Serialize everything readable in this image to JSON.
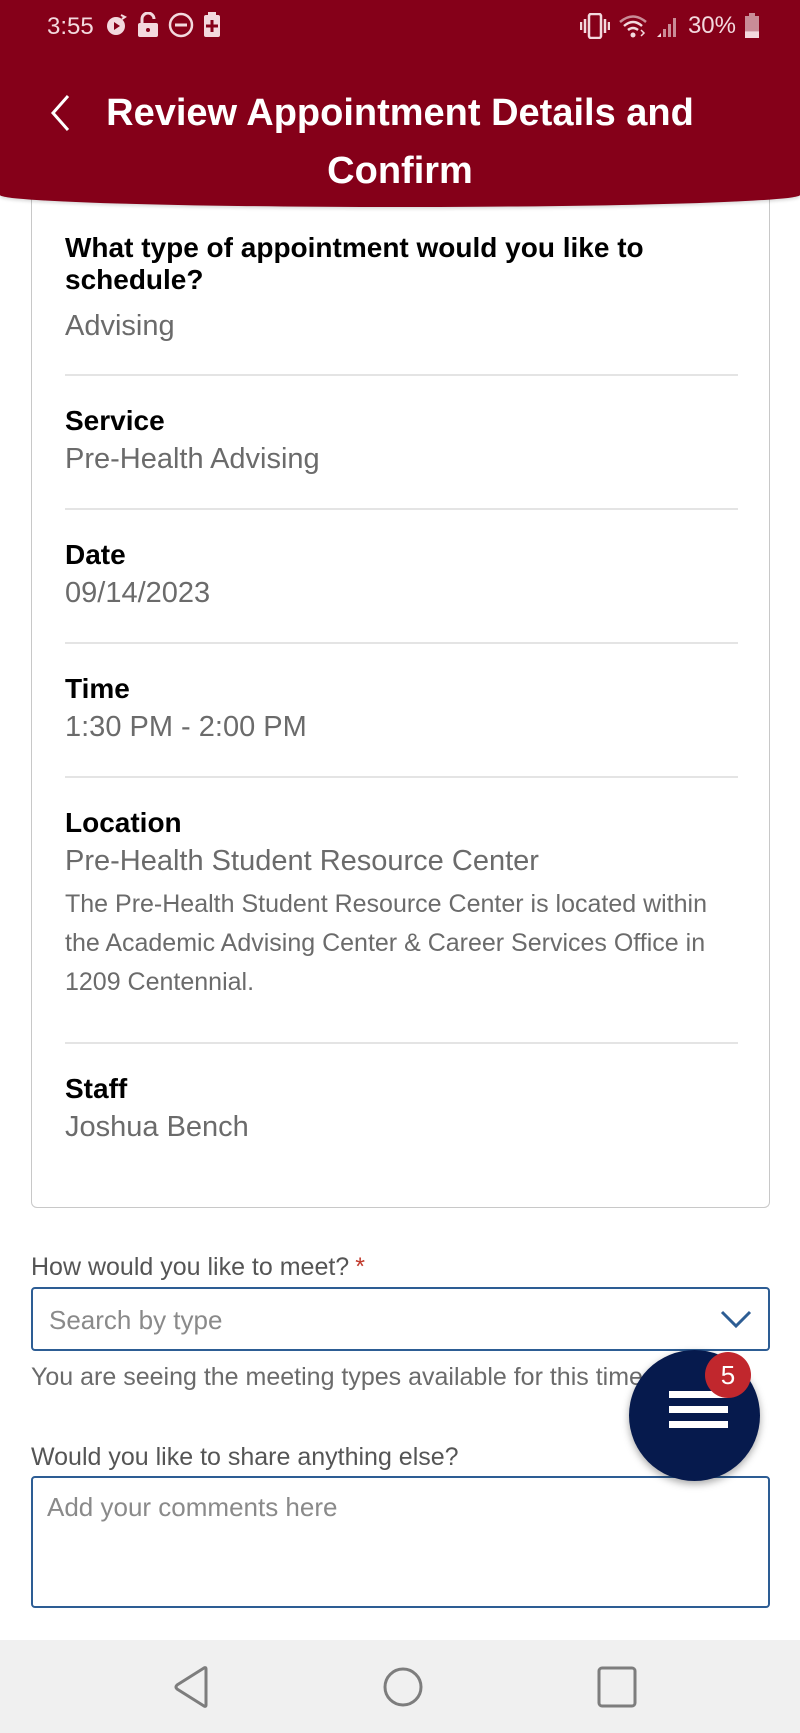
{
  "status_bar": {
    "time": "3:55",
    "left_icons": [
      "media-timer-icon",
      "lock-icon",
      "do-not-disturb-icon",
      "battery-saver-icon"
    ],
    "right_icons": [
      "vibrate-icon",
      "wifi-icon",
      "signal-icon"
    ],
    "battery_percent": "30%",
    "battery_level": 0.3
  },
  "header": {
    "back_icon": "chevron-left-icon",
    "title": "Review Appointment Details and Confirm"
  },
  "details": [
    {
      "label": "What type of appointment would you like to schedule?",
      "value": "Advising"
    },
    {
      "label": "Service",
      "value": "Pre-Health Advising"
    },
    {
      "label": "Date",
      "value": "09/14/2023"
    },
    {
      "label": "Time",
      "value": "1:30 PM - 2:00 PM"
    },
    {
      "label": "Location",
      "value": "Pre-Health Student Resource Center",
      "description": "The Pre-Health Student Resource Center is located within the Academic Advising Center & Career Services Office in 1209 Centennial."
    },
    {
      "label": "Staff",
      "value": "Joshua Bench"
    }
  ],
  "form": {
    "meeting_label": "How would you like to meet?",
    "required_marker": "*",
    "meeting_placeholder": "Search by type",
    "meeting_value": "",
    "meeting_hint": "You are seeing the meeting types available for this time.",
    "comments_label": "Would you like to share anything else?",
    "comments_placeholder": "Add your comments here",
    "comments_value": ""
  },
  "fab": {
    "icon": "menu-icon",
    "badge_count": "5"
  },
  "nav_bar": {
    "buttons": [
      "back-nav-icon",
      "home-nav-icon",
      "recents-nav-icon"
    ]
  },
  "colors": {
    "brand": "#850019",
    "fab": "#061a4d",
    "badge": "#c1272d",
    "input_border": "#2d5d94"
  }
}
